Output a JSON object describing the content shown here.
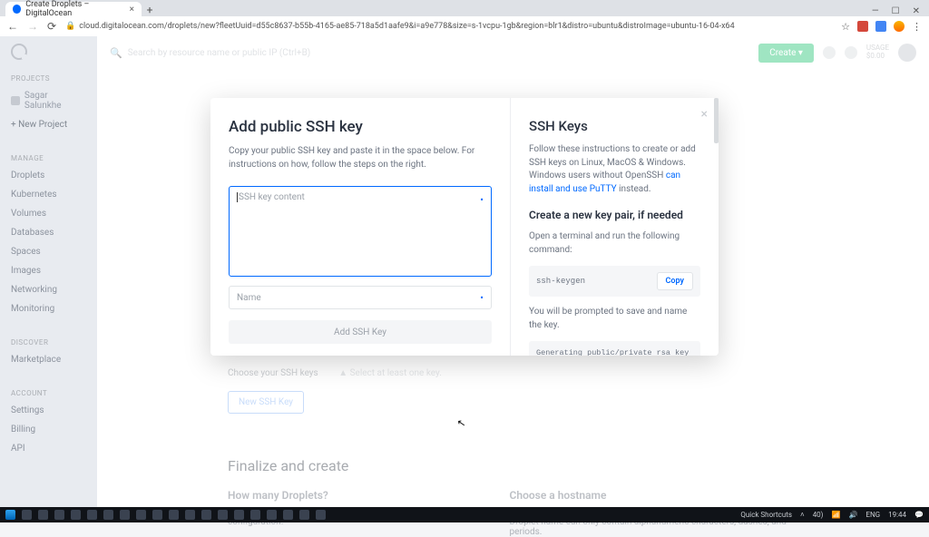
{
  "browser": {
    "tab_title": "Create Droplets – DigitalOcean",
    "url": "cloud.digitalocean.com/droplets/new?fleetUuid=d55c8637-b55b-4165-ae85-718a5d1aafe9&i=a9e778&size=s-1vcpu-1gb&region=blr1&distro=ubuntu&distroImage=ubuntu-16-04-x64"
  },
  "topbar": {
    "search_placeholder": "Search by resource name or public IP (Ctrl+B)",
    "create_label": "Create",
    "usage_label": "USAGE",
    "usage_value": "$0.00"
  },
  "sidebar": {
    "sections": {
      "projects": "PROJECTS",
      "manage": "MANAGE",
      "discover": "DISCOVER",
      "account": "ACCOUNT"
    },
    "project_name": "Sagar Salunkhe",
    "new_project": "+  New Project",
    "manage_items": [
      "Droplets",
      "Kubernetes",
      "Volumes",
      "Databases",
      "Spaces",
      "Images",
      "Networking",
      "Monitoring"
    ],
    "discover_items": [
      "Marketplace"
    ],
    "account_items": [
      "Settings",
      "Billing",
      "API"
    ]
  },
  "bg": {
    "choose_label": "Choose your SSH keys",
    "warn_label": "Select at least one key.",
    "new_ssh_label": "New SSH Key",
    "finalize_title": "Finalize and create",
    "col1_title": "How many Droplets?",
    "col1_text": "Deploy multiple Droplets with the same configuration.",
    "col2_title": "Choose a hostname",
    "col2_text": "Give your Droplets an identifying name you will remember them by. Your Droplet name can only contain alphanumeric characters, dashes, and periods."
  },
  "modal": {
    "left_title": "Add public SSH key",
    "left_sub": "Copy your public SSH key and paste it in the space below. For instructions on how, follow the steps on the right.",
    "textarea_placeholder": "SSH key content",
    "name_placeholder": "Name",
    "add_button": "Add SSH Key",
    "right_title": "SSH Keys",
    "right_text_a": "Follow these instructions to create or add SSH keys on Linux, MacOS & Windows. Windows users without OpenSSH ",
    "right_link": "can install and use PuTTY",
    "right_text_b": " instead.",
    "right_h3": "Create a new key pair, if needed",
    "right_text2": "Open a terminal and run the following command:",
    "code1": "ssh-keygen",
    "copy_label": "Copy",
    "right_text3": "You will be prompted to save and name the key.",
    "code2": "Generating public/private rsa key pair. Enter file in which to save the key (/Users/USER/.ssh/id_rsa):"
  },
  "taskbar": {
    "quick": "Quick Shortcuts",
    "net": "40)",
    "lang": "ENG",
    "time": "19:44"
  }
}
